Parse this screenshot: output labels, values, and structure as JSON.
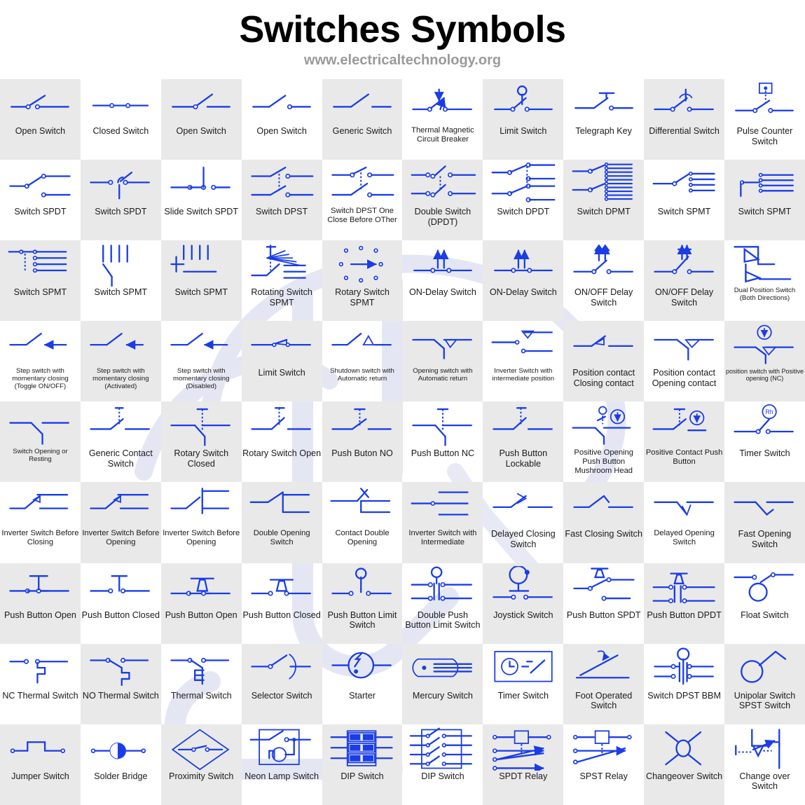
{
  "header": {
    "title": "Switches Symbols",
    "subtitle": "www.electricaltechnology.org"
  },
  "colors": {
    "symbol_blue": "#1a3de8",
    "cell_alt_background": "#e9e9e9",
    "cell_background": "#ffffff",
    "title_color": "#000000",
    "subtitle_color": "#9a9a9a",
    "watermark": "#e3e6f2"
  },
  "grid": {
    "columns": 10,
    "rows": 9
  },
  "chart_data": {
    "type": "table",
    "title": "Switches Symbols",
    "subtitle": "www.electricaltechnology.org",
    "columns": 10,
    "rows": 9,
    "note": "Reference sheet of 90 electrical switch schematic symbols arranged in a 10x10 checkerboard grid",
    "cells": [
      {
        "label": "Open Switch",
        "icon": "open-switch-symbol",
        "size": "md"
      },
      {
        "label": "Closed Switch",
        "icon": "closed-switch-symbol",
        "size": "md"
      },
      {
        "label": "Open Switch",
        "icon": "open-switch-2-symbol",
        "size": "md"
      },
      {
        "label": "Open Switch",
        "icon": "open-switch-3-symbol",
        "size": "md"
      },
      {
        "label": "Generic Switch",
        "icon": "generic-switch-symbol",
        "size": "md"
      },
      {
        "label": "Thermal Magnetic Circuit Breaker",
        "icon": "thermal-magnetic-circuit-breaker-symbol",
        "size": "sm"
      },
      {
        "label": "Limit Switch",
        "icon": "limit-switch-symbol",
        "size": "md"
      },
      {
        "label": "Telegraph Key",
        "icon": "telegraph-key-symbol",
        "size": "md"
      },
      {
        "label": "Differential Switch",
        "icon": "differential-switch-symbol",
        "size": "md"
      },
      {
        "label": "Pulse Counter Switch",
        "icon": "pulse-counter-switch-symbol",
        "size": "md"
      },
      {
        "label": "Switch SPDT",
        "icon": "switch-spdt-symbol",
        "size": "md"
      },
      {
        "label": "Switch SPDT",
        "icon": "switch-spdt-2-symbol",
        "size": "md"
      },
      {
        "label": "Slide Switch SPDT",
        "icon": "slide-switch-spdt-symbol",
        "size": "md"
      },
      {
        "label": "Switch DPST",
        "icon": "switch-dpst-symbol",
        "size": "md"
      },
      {
        "label": "Switch DPST One Close Before OTher",
        "icon": "switch-dpst-one-close-before-other-symbol",
        "size": "sm"
      },
      {
        "label": "Double Switch (DPDT)",
        "icon": "double-switch-dpdt-symbol",
        "size": "md"
      },
      {
        "label": "Switch DPDT",
        "icon": "switch-dpdt-symbol",
        "size": "md"
      },
      {
        "label": "Switch DPMT",
        "icon": "switch-dpmt-symbol",
        "size": "md"
      },
      {
        "label": "Switch SPMT",
        "icon": "switch-spmt-symbol",
        "size": "md"
      },
      {
        "label": "Switch SPMT",
        "icon": "switch-spmt-2-symbol",
        "size": "md"
      },
      {
        "label": "Switch SPMT",
        "icon": "switch-spmt-3-symbol",
        "size": "md"
      },
      {
        "label": "Switch SPMT",
        "icon": "switch-spmt-4-symbol",
        "size": "md"
      },
      {
        "label": "Switch SPMT",
        "icon": "switch-spmt-5-symbol",
        "size": "md"
      },
      {
        "label": "Rotating Switch SPMT",
        "icon": "rotating-switch-spmt-symbol",
        "size": "md"
      },
      {
        "label": "Rotary Switch SPMT",
        "icon": "rotary-switch-spmt-symbol",
        "size": "md"
      },
      {
        "label": "ON-Delay Switch",
        "icon": "on-delay-switch-symbol",
        "size": "md"
      },
      {
        "label": "ON-Delay Switch",
        "icon": "on-delay-switch-2-symbol",
        "size": "md"
      },
      {
        "label": "ON/OFF Delay Switch",
        "icon": "on-off-delay-switch-symbol",
        "size": "md"
      },
      {
        "label": "ON/OFF Delay Switch",
        "icon": "on-off-delay-switch-2-symbol",
        "size": "md"
      },
      {
        "label": "Dual Position Switch (Both Directions)",
        "icon": "dual-position-switch-symbol",
        "size": "xs"
      },
      {
        "label": "Step switch with momentary closing (Toggle ON/OFF)",
        "icon": "step-switch-toggle-symbol",
        "size": "xs"
      },
      {
        "label": "Step switch with momentary closing (Activated)",
        "icon": "step-switch-activated-symbol",
        "size": "xs"
      },
      {
        "label": "Step switch with momentary closing (Disabled)",
        "icon": "step-switch-disabled-symbol",
        "size": "xs"
      },
      {
        "label": "Limit Switch",
        "icon": "limit-switch-2-symbol",
        "size": "md"
      },
      {
        "label": "Shutdown switch with Automatic return",
        "icon": "shutdown-switch-automatic-return-symbol",
        "size": "xs"
      },
      {
        "label": "Opening switch with Automatic return",
        "icon": "opening-switch-automatic-return-symbol",
        "size": "xs"
      },
      {
        "label": "Inverter Switch with intermediate position",
        "icon": "inverter-switch-intermediate-position-symbol",
        "size": "xs"
      },
      {
        "label": "Position contact Closing contact",
        "icon": "position-contact-closing-symbol",
        "size": "md"
      },
      {
        "label": "Position contact Opening contact",
        "icon": "position-contact-opening-symbol",
        "size": "md"
      },
      {
        "label": "position switch with Positive opening (NC)",
        "icon": "position-switch-positive-opening-symbol",
        "size": "xxs"
      },
      {
        "label": "Switch Opening or Resting",
        "icon": "switch-opening-or-resting-symbol",
        "size": "xs"
      },
      {
        "label": "Generic Contact Switch",
        "icon": "generic-contact-switch-symbol",
        "size": "md"
      },
      {
        "label": "Rotary Switch Closed",
        "icon": "rotary-switch-closed-symbol",
        "size": "md"
      },
      {
        "label": "Rotary Switch Open",
        "icon": "rotary-switch-open-symbol",
        "size": "md"
      },
      {
        "label": "Push Buton NO",
        "icon": "push-button-no-symbol",
        "size": "md"
      },
      {
        "label": "Push Button NC",
        "icon": "push-button-nc-symbol",
        "size": "md"
      },
      {
        "label": "Push Button Lockable",
        "icon": "push-button-lockable-symbol",
        "size": "md"
      },
      {
        "label": "Positive Opening Push Button Mushroom Head",
        "icon": "positive-opening-push-button-mushroom-head-symbol",
        "size": "sm"
      },
      {
        "label": "Positive Contact Push Button",
        "icon": "positive-contact-push-button-symbol",
        "size": "sm"
      },
      {
        "label": "Timer Switch",
        "icon": "timer-switch-rh-symbol",
        "size": "md"
      },
      {
        "label": "Inverter Switch Before Closing",
        "icon": "inverter-switch-before-closing-symbol",
        "size": "sm"
      },
      {
        "label": "Inverter Switch Before Opening",
        "icon": "inverter-switch-before-opening-symbol",
        "size": "sm"
      },
      {
        "label": "Inverter Switch Before Opening",
        "icon": "inverter-switch-before-opening-2-symbol",
        "size": "sm"
      },
      {
        "label": "Double Opening Switch",
        "icon": "double-opening-switch-symbol",
        "size": "sm"
      },
      {
        "label": "Contact Double Opening",
        "icon": "contact-double-opening-symbol",
        "size": "sm"
      },
      {
        "label": "Inverter Switch with Intermediate",
        "icon": "inverter-switch-with-intermediate-symbol",
        "size": "sm"
      },
      {
        "label": "Delayed Closing Switch",
        "icon": "delayed-closing-switch-symbol",
        "size": "md"
      },
      {
        "label": "Fast Closing Switch",
        "icon": "fast-closing-switch-symbol",
        "size": "md"
      },
      {
        "label": "Delayed Opening Switch",
        "icon": "delayed-opening-switch-symbol",
        "size": "sm"
      },
      {
        "label": "Fast Opening Switch",
        "icon": "fast-opening-switch-symbol",
        "size": "md"
      },
      {
        "label": "Push Button Open",
        "icon": "push-button-open-symbol",
        "size": "md"
      },
      {
        "label": "Push Button Closed",
        "icon": "push-button-closed-symbol",
        "size": "md"
      },
      {
        "label": "Push Button Open",
        "icon": "push-button-open-mushroom-symbol",
        "size": "md"
      },
      {
        "label": "Push Button Closed",
        "icon": "push-button-closed-mushroom-symbol",
        "size": "md"
      },
      {
        "label": "Push Button Limit Switch",
        "icon": "push-button-limit-switch-symbol",
        "size": "md"
      },
      {
        "label": "Double Push Button Limit Switch",
        "icon": "double-push-button-limit-switch-symbol",
        "size": "md"
      },
      {
        "label": "Joystick Switch",
        "icon": "joystick-switch-symbol",
        "size": "md"
      },
      {
        "label": "Push Button SPDT",
        "icon": "push-button-spdt-symbol",
        "size": "md"
      },
      {
        "label": "Push Button DPDT",
        "icon": "push-button-dpdt-symbol",
        "size": "md"
      },
      {
        "label": "Float Switch",
        "icon": "float-switch-symbol",
        "size": "md"
      },
      {
        "label": "NC Thermal Switch",
        "icon": "nc-thermal-switch-symbol",
        "size": "md"
      },
      {
        "label": "NO Thermal Switch",
        "icon": "no-thermal-switch-symbol",
        "size": "md"
      },
      {
        "label": "Thermal Switch",
        "icon": "thermal-switch-symbol",
        "size": "md"
      },
      {
        "label": "Selector Switch",
        "icon": "selector-switch-symbol",
        "size": "md"
      },
      {
        "label": "Starter",
        "icon": "starter-symbol",
        "size": "md"
      },
      {
        "label": "Mercury Switch",
        "icon": "mercury-switch-symbol",
        "size": "md"
      },
      {
        "label": "Timer Switch",
        "icon": "timer-switch-clock-symbol",
        "size": "md"
      },
      {
        "label": "Foot Operated Switch",
        "icon": "foot-operated-switch-symbol",
        "size": "md"
      },
      {
        "label": "Switch DPST BBM",
        "icon": "switch-dpst-bbm-symbol",
        "size": "md"
      },
      {
        "label": "Unipolar Switch SPST Switch",
        "icon": "unipolar-switch-spst-symbol",
        "size": "md"
      },
      {
        "label": "Jumper Switch",
        "icon": "jumper-switch-symbol",
        "size": "md"
      },
      {
        "label": "Solder Bridge",
        "icon": "solder-bridge-symbol",
        "size": "md"
      },
      {
        "label": "Proximity Switch",
        "icon": "proximity-switch-symbol",
        "size": "md"
      },
      {
        "label": "Neon Lamp Switch",
        "icon": "neon-lamp-switch-symbol",
        "size": "md"
      },
      {
        "label": "DIP Switch",
        "icon": "dip-switch-symbol",
        "size": "md"
      },
      {
        "label": "DIP Switch",
        "icon": "dip-switch-2-symbol",
        "size": "md"
      },
      {
        "label": "SPDT Relay",
        "icon": "spdt-relay-symbol",
        "size": "md"
      },
      {
        "label": "SPST Relay",
        "icon": "spst-relay-symbol",
        "size": "md"
      },
      {
        "label": "Changeover Switch",
        "icon": "changeover-switch-symbol",
        "size": "md"
      },
      {
        "label": "Change over Switch",
        "icon": "change-over-switch-symbol",
        "size": "md"
      }
    ]
  }
}
